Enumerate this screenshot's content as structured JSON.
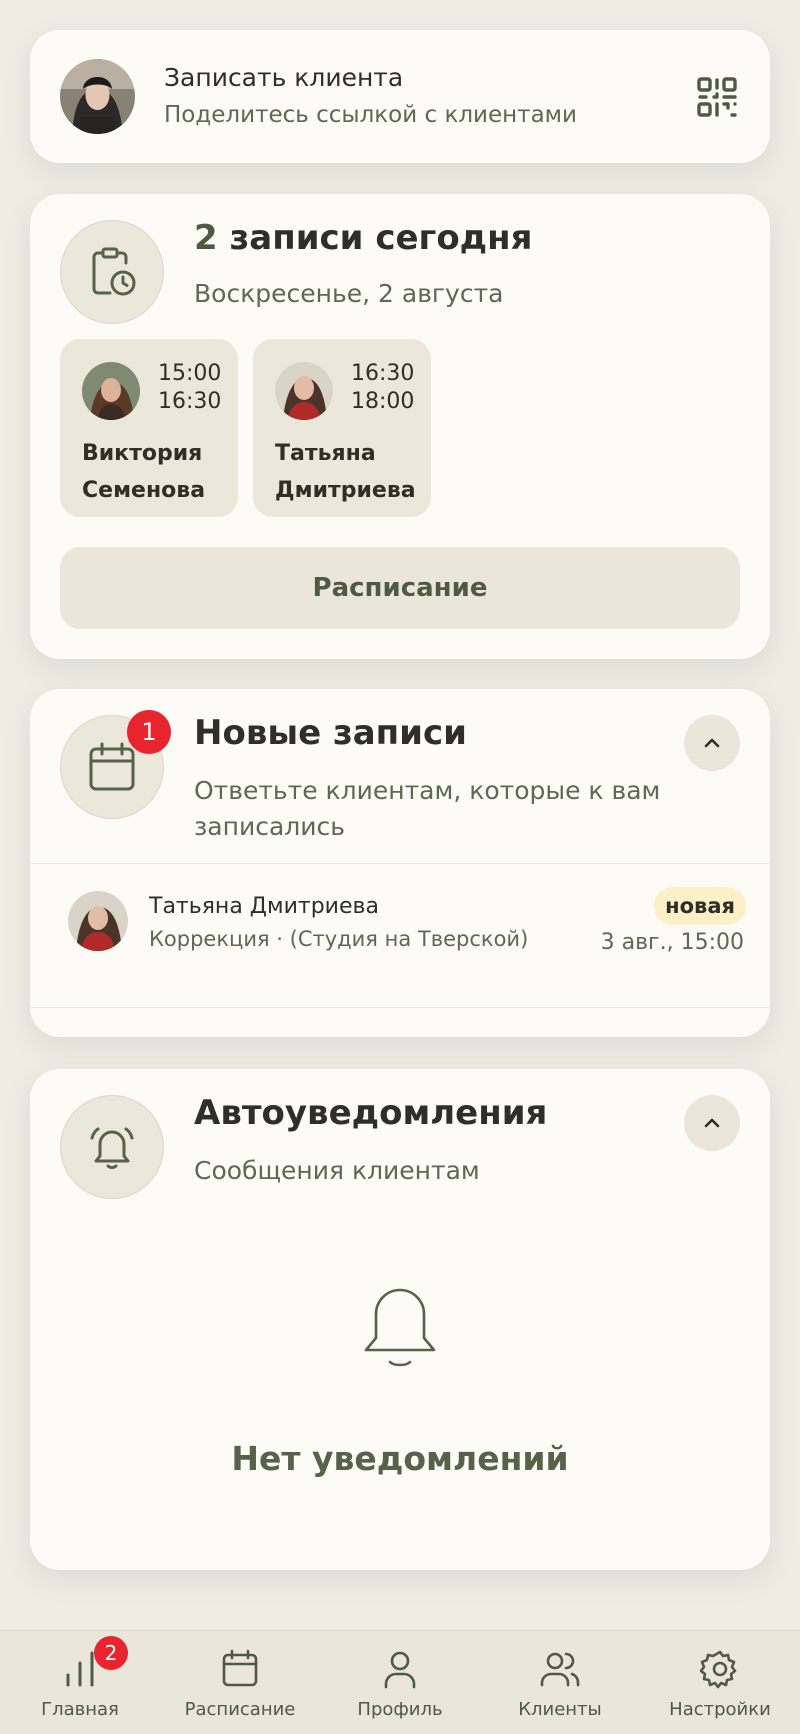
{
  "share": {
    "title": "Записать клиента",
    "subtitle": "Поделитесь ссылкой с клиентами",
    "qr_icon": "qr-code-icon"
  },
  "today": {
    "count": "2",
    "title_rest": "записи сегодня",
    "date": "Воскресенье, 2 августа",
    "icon": "clipboard-clock-icon",
    "appointments": [
      {
        "start": "15:00",
        "end": "16:30",
        "first_name": "Виктория",
        "last_name": "Семенова"
      },
      {
        "start": "16:30",
        "end": "18:00",
        "first_name": "Татьяна",
        "last_name": "Дмитриева"
      }
    ],
    "schedule_button": "Расписание"
  },
  "new_bookings": {
    "title": "Новые записи",
    "subtitle": "Ответьте клиентам, которые к вам записались",
    "badge": "1",
    "icon": "calendar-icon",
    "items": [
      {
        "name": "Татьяна Дмитриева",
        "service": "Коррекция · (Студия на Тверской)",
        "status": "новая",
        "when": "3 авг., 15:00"
      }
    ]
  },
  "notifications": {
    "title": "Автоуведомления",
    "subtitle": "Сообщения клиентам",
    "icon": "bell-icon",
    "empty_text": "Нет уведомлений"
  },
  "tabs": [
    {
      "label": "Главная",
      "icon": "chart-bars-icon",
      "badge": "2"
    },
    {
      "label": "Расписание",
      "icon": "calendar-icon"
    },
    {
      "label": "Профиль",
      "icon": "user-icon"
    },
    {
      "label": "Клиенты",
      "icon": "users-icon"
    },
    {
      "label": "Настройки",
      "icon": "gear-icon"
    }
  ],
  "colors": {
    "background": "#efece4",
    "card": "#fcfbf6",
    "accent_green": "#4f5a44",
    "badge_red": "#e8252f",
    "status_yellow": "#fbf0c7"
  }
}
